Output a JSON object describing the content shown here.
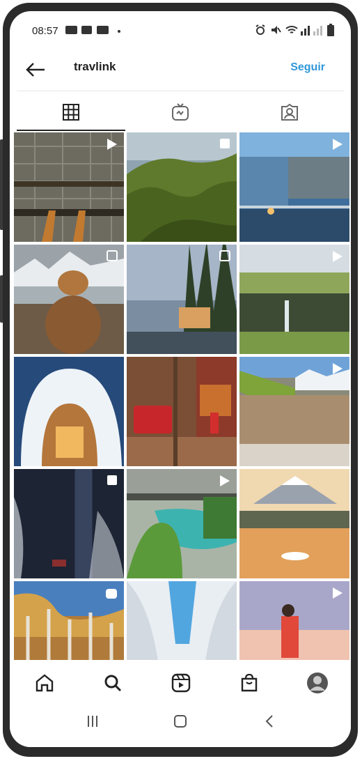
{
  "status_bar": {
    "time": "08:57",
    "left_icons": [
      "youtube-icon",
      "linkedin-icon",
      "youtube-icon"
    ],
    "right_icons": [
      "alarm-icon",
      "mute-icon",
      "wifi-icon",
      "signal-icon",
      "signal-icon",
      "battery-icon"
    ]
  },
  "header": {
    "title": "travlink",
    "follow_label": "Seguir"
  },
  "tabs": [
    {
      "name": "grid",
      "icon": "grid-icon",
      "active": true
    },
    {
      "name": "igtv",
      "icon": "tv-icon",
      "active": false
    },
    {
      "name": "tagged",
      "icon": "tagged-person-icon",
      "active": false
    }
  ],
  "grid": [
    {
      "desc": "aerial city feet",
      "badge": "video-icon"
    },
    {
      "desc": "green hills",
      "badge": "carousel-icon"
    },
    {
      "desc": "rock bar bali",
      "badge": "video-icon"
    },
    {
      "desc": "dog and cat",
      "badge": "carousel-icon"
    },
    {
      "desc": "forest cabin",
      "badge": "carousel-icon"
    },
    {
      "desc": "waterfall cliffs",
      "badge": "video-icon"
    },
    {
      "desc": "snow igloo",
      "badge": ""
    },
    {
      "desc": "london bus",
      "badge": ""
    },
    {
      "desc": "alps lounge",
      "badge": "video-icon"
    },
    {
      "desc": "starry snow night",
      "badge": "carousel-icon"
    },
    {
      "desc": "pool tropical",
      "badge": "video-icon"
    },
    {
      "desc": "mount fuji swans",
      "badge": ""
    },
    {
      "desc": "autumn trees",
      "badge": "igtv-icon"
    },
    {
      "desc": "snow avenue",
      "badge": ""
    },
    {
      "desc": "person snow sunset",
      "badge": "video-icon"
    }
  ],
  "bottom_nav": [
    "home-icon",
    "search-icon",
    "reels-icon",
    "shop-icon",
    "profile-avatar"
  ],
  "system_nav": [
    "recent-apps-icon",
    "home-button-icon",
    "back-nav-icon"
  ]
}
